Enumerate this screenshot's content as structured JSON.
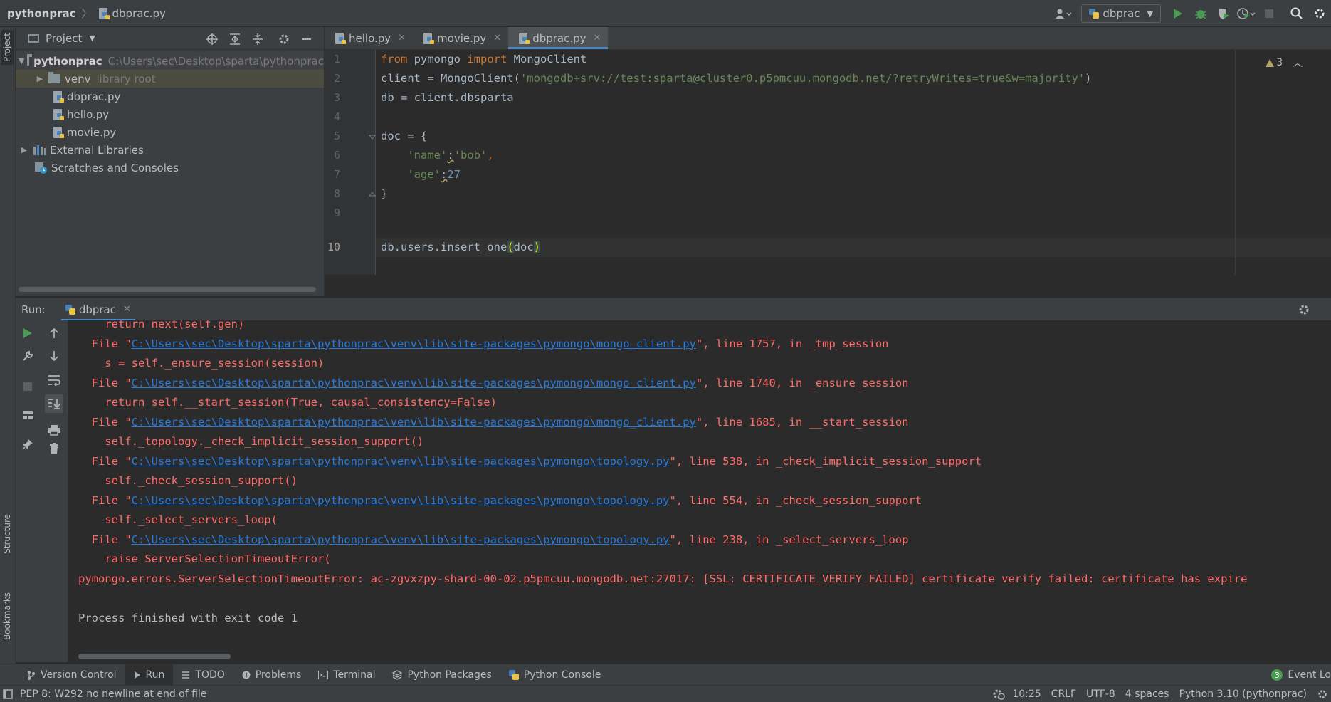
{
  "navbar": {
    "project": "pythonprac",
    "file": "dbprac.py",
    "run_config": "dbprac"
  },
  "project_panel": {
    "title": "Project",
    "tree": [
      {
        "label": "pythonprac",
        "hint": "C:\\Users\\sec\\Desktop\\sparta\\pythonprac"
      },
      {
        "label": "venv",
        "hint": "library root"
      },
      {
        "label": "dbprac.py"
      },
      {
        "label": "hello.py"
      },
      {
        "label": "movie.py"
      },
      {
        "label": "External Libraries"
      },
      {
        "label": "Scratches and Consoles"
      }
    ]
  },
  "editor": {
    "tabs": [
      "hello.py",
      "movie.py",
      "dbprac.py"
    ],
    "active_tab": "dbprac.py",
    "line_numbers": [
      "1",
      "2",
      "3",
      "4",
      "5",
      "6",
      "7",
      "8",
      "9",
      "10"
    ],
    "current_line": 10,
    "warnings": "3",
    "code": {
      "l1_kw1": "from",
      "l1_mod": " pymongo ",
      "l1_kw2": "import",
      "l1_cls": " MongoClient",
      "l2_pre": "client = MongoClient(",
      "l2_str": "'mongodb+srv://test:sparta@cluster0.p5pmcuu.mongodb.net/?retryWrites=true&w=majority'",
      "l2_post": ")",
      "l3": "db = client.dbsparta",
      "l5": "doc = {",
      "l6_pre": "    ",
      "l6_key": "'name'",
      "l6_colon": ":",
      "l6_val": "'bob'",
      "l6_post": ",",
      "l7_pre": "    ",
      "l7_key": "'age'",
      "l7_colon": ":",
      "l7_val": "27",
      "l8": "}",
      "l10_pre": "db.users.insert_one",
      "l10_open": "(",
      "l10_arg": "doc",
      "l10_close": ")"
    }
  },
  "run_panel": {
    "label": "Run:",
    "tab": "dbprac",
    "console": [
      {
        "pre": "    return next(self.gen)"
      },
      {
        "pre": "  File \"",
        "link": "C:\\Users\\sec\\Desktop\\sparta\\pythonprac\\venv\\lib\\site-packages\\pymongo\\mongo_client.py",
        "post": "\", line 1757, in _tmp_session"
      },
      {
        "pre": "    s = self._ensure_session(session)"
      },
      {
        "pre": "  File \"",
        "link": "C:\\Users\\sec\\Desktop\\sparta\\pythonprac\\venv\\lib\\site-packages\\pymongo\\mongo_client.py",
        "post": "\", line 1740, in _ensure_session"
      },
      {
        "pre": "    return self.__start_session(True, causal_consistency=False)"
      },
      {
        "pre": "  File \"",
        "link": "C:\\Users\\sec\\Desktop\\sparta\\pythonprac\\venv\\lib\\site-packages\\pymongo\\mongo_client.py",
        "post": "\", line 1685, in __start_session"
      },
      {
        "pre": "    self._topology._check_implicit_session_support()"
      },
      {
        "pre": "  File \"",
        "link": "C:\\Users\\sec\\Desktop\\sparta\\pythonprac\\venv\\lib\\site-packages\\pymongo\\topology.py",
        "post": "\", line 538, in _check_implicit_session_support"
      },
      {
        "pre": "    self._check_session_support()"
      },
      {
        "pre": "  File \"",
        "link": "C:\\Users\\sec\\Desktop\\sparta\\pythonprac\\venv\\lib\\site-packages\\pymongo\\topology.py",
        "post": "\", line 554, in _check_session_support"
      },
      {
        "pre": "    self._select_servers_loop("
      },
      {
        "pre": "  File \"",
        "link": "C:\\Users\\sec\\Desktop\\sparta\\pythonprac\\venv\\lib\\site-packages\\pymongo\\topology.py",
        "post": "\", line 238, in _select_servers_loop"
      },
      {
        "pre": "    raise ServerSelectionTimeoutError("
      },
      {
        "pre": "pymongo.errors.ServerSelectionTimeoutError: ac-zgvxzpy-shard-00-02.p5pmcuu.mongodb.net:27017: [SSL: CERTIFICATE_VERIFY_FAILED] certificate verify failed: certificate has expire"
      },
      {
        "pre": ""
      },
      {
        "pre": "Process finished with exit code 1"
      }
    ]
  },
  "bottom_tabs": [
    "Version Control",
    "Run",
    "TODO",
    "Problems",
    "Terminal",
    "Python Packages",
    "Python Console"
  ],
  "event_log": {
    "count": "3",
    "label": "Event Lo"
  },
  "side_tabs": {
    "project": "Project",
    "structure": "Structure",
    "bookmarks": "Bookmarks"
  },
  "status": {
    "message": "PEP 8: W292 no newline at end of file",
    "position": "10:25",
    "line_sep": "CRLF",
    "encoding": "UTF-8",
    "indent": "4 spaces",
    "interpreter": "Python 3.10 (pythonprac)"
  },
  "colors": {
    "error": "#ff6b68",
    "link": "#287bde",
    "keyword": "#cc7832",
    "string": "#6a8759",
    "number": "#6897bb",
    "accent": "#4a88c7",
    "run_green": "#499c54"
  }
}
